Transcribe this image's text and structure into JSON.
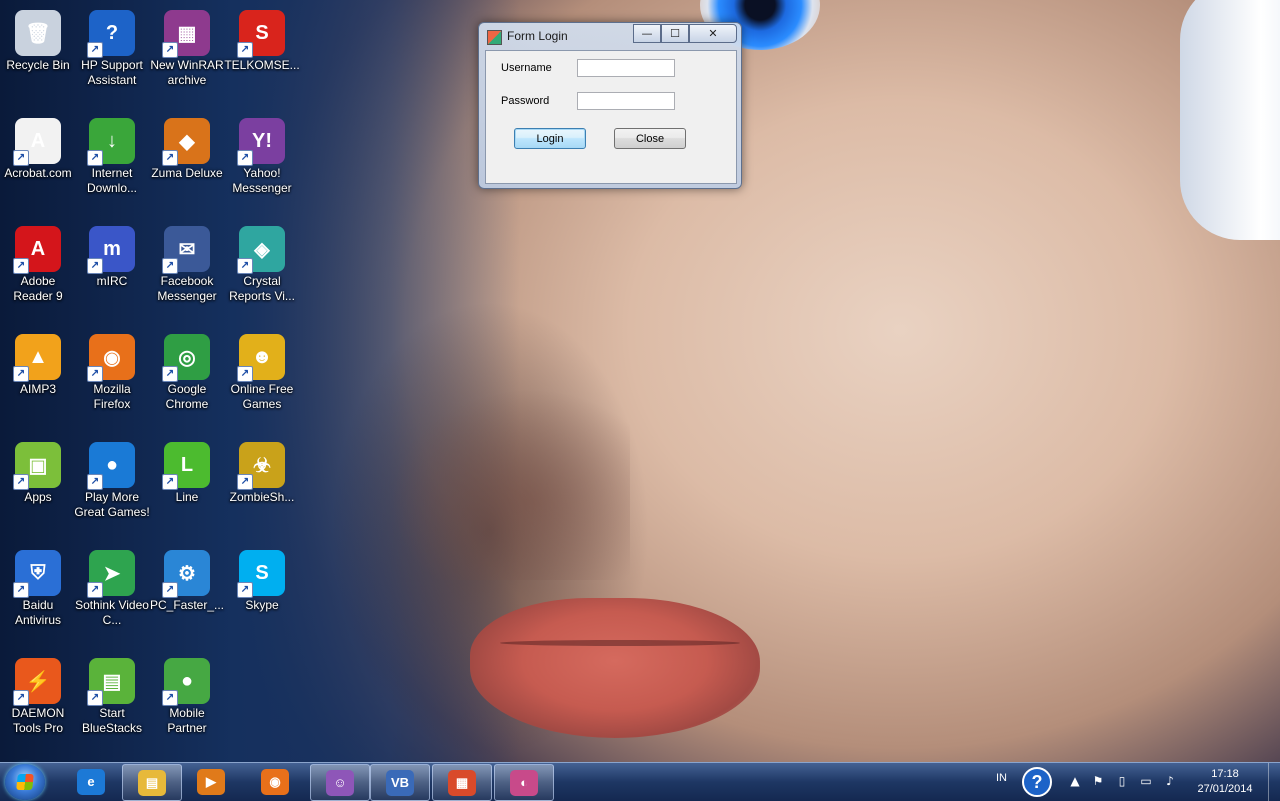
{
  "desktop": {
    "icons": [
      {
        "label": "Recycle Bin",
        "icon": "recycle-bin-icon",
        "color": "#c9d2de"
      },
      {
        "label": "Acrobat.com",
        "icon": "acrobat-com-icon",
        "color": "#f2f2f2"
      },
      {
        "label": "Adobe Reader 9",
        "icon": "adobe-reader-icon",
        "color": "#d4151b"
      },
      {
        "label": "AIMP3",
        "icon": "aimp-icon",
        "color": "#f2a21b"
      },
      {
        "label": "Apps",
        "icon": "apps-android-icon",
        "color": "#7cbf3a"
      },
      {
        "label": "Baidu Antivirus",
        "icon": "baidu-antivirus-icon",
        "color": "#2a6fd6"
      },
      {
        "label": "DAEMON Tools Pro",
        "icon": "daemon-tools-icon",
        "color": "#e9581c"
      },
      {
        "label": "HP Support Assistant",
        "icon": "hp-help-icon",
        "color": "#1d63c8"
      },
      {
        "label": "Internet Downlo...",
        "icon": "internet-download-manager-icon",
        "color": "#3aa63a"
      },
      {
        "label": "mIRC",
        "icon": "mirc-icon",
        "color": "#3a56c8"
      },
      {
        "label": "Mozilla Firefox",
        "icon": "firefox-icon",
        "color": "#e8701a"
      },
      {
        "label": "Play More Great Games!",
        "icon": "play-games-icon",
        "color": "#1a7ad6"
      },
      {
        "label": "Sothink Video C...",
        "icon": "sothink-video-icon",
        "color": "#2ea44f"
      },
      {
        "label": "Start BlueStacks",
        "icon": "bluestacks-icon",
        "color": "#5ab33a"
      },
      {
        "label": "New WinRAR archive",
        "icon": "winrar-icon",
        "color": "#8e3a8e"
      },
      {
        "label": "Zuma Deluxe",
        "icon": "zuma-deluxe-icon",
        "color": "#d9731a"
      },
      {
        "label": "Facebook Messenger",
        "icon": "facebook-messenger-icon",
        "color": "#3b5998"
      },
      {
        "label": "Google Chrome",
        "icon": "chrome-icon",
        "color": "#2f9e44"
      },
      {
        "label": "Line",
        "icon": "line-icon",
        "color": "#4cbb2f"
      },
      {
        "label": "PC_Faster_...",
        "icon": "pc-faster-icon",
        "color": "#2a86d6"
      },
      {
        "label": "Mobile Partner",
        "icon": "mobile-partner-icon",
        "color": "#46a843"
      },
      {
        "label": "TELKOMSE...",
        "icon": "telkomsel-icon",
        "color": "#d9241c"
      },
      {
        "label": "Yahoo! Messenger",
        "icon": "yahoo-messenger-icon",
        "color": "#7b3fa0"
      },
      {
        "label": "Crystal Reports Vi...",
        "icon": "crystal-reports-icon",
        "color": "#2fa6a0"
      },
      {
        "label": "Online Free Games",
        "icon": "online-games-icon",
        "color": "#e2b01a"
      },
      {
        "label": "ZombieSh...",
        "icon": "zombie-shooter-icon",
        "color": "#c9a21a"
      },
      {
        "label": "Skype",
        "icon": "skype-icon",
        "color": "#00aff0"
      }
    ]
  },
  "login_window": {
    "title": "Form Login",
    "minimize": "—",
    "maximize": "☐",
    "close": "✕",
    "username_label": "Username",
    "username_value": "",
    "password_label": "Password",
    "password_value": "",
    "login_button": "Login",
    "close_button": "Close"
  },
  "taskbar": {
    "pinned": [
      {
        "icon": "internet-explorer-icon",
        "glyph": "e",
        "color": "#1c79d6",
        "active": false
      },
      {
        "icon": "windows-explorer-icon",
        "glyph": "▤",
        "color": "#e7b93a",
        "active": true
      },
      {
        "icon": "media-player-icon",
        "glyph": "▶",
        "color": "#e07a1a",
        "active": false
      },
      {
        "icon": "firefox-icon",
        "glyph": "◉",
        "color": "#e8701a",
        "active": false
      },
      {
        "icon": "yahoo-messenger-icon",
        "glyph": "☺",
        "color": "#8e56b8",
        "active": true
      },
      {
        "icon": "visual-basic-icon",
        "glyph": "VB",
        "color": "#3a6ab8",
        "active": true
      },
      {
        "icon": "control-panel-icon",
        "glyph": "▦",
        "color": "#d94a2a",
        "active": true
      },
      {
        "icon": "paint-icon",
        "glyph": "◐",
        "color": "#c84a8a",
        "active": true
      }
    ],
    "tray": {
      "language": "IN",
      "help_glyph": "?",
      "time": "17:18",
      "date": "27/01/2014"
    }
  }
}
